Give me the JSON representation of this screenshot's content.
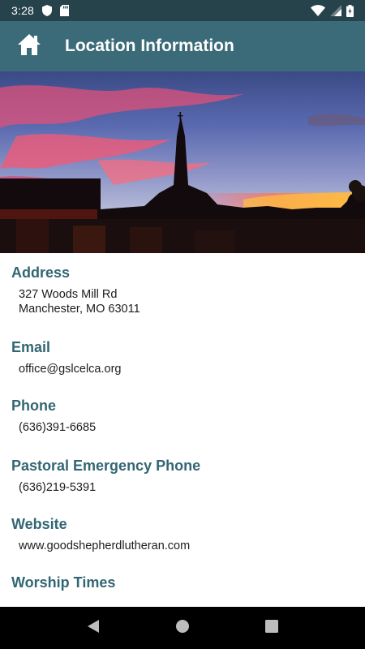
{
  "status_bar": {
    "time": "3:28",
    "icons": [
      "shield-icon",
      "sd-card-icon",
      "wifi-icon",
      "signal-icon",
      "battery-charging-icon"
    ]
  },
  "app_bar": {
    "title": "Location Information",
    "home_icon": "home-icon"
  },
  "hero": {
    "description": "church-steeple-sunset-photo"
  },
  "sections": {
    "address": {
      "label": "Address",
      "line1": "327 Woods Mill Rd",
      "line2": "Manchester, MO 63011"
    },
    "email": {
      "label": "Email",
      "value": "office@gslcelca.org"
    },
    "phone": {
      "label": "Phone",
      "value": "(636)391-6685"
    },
    "pastoral": {
      "label": "Pastoral Emergency Phone",
      "value": "(636)219-5391"
    },
    "website": {
      "label": "Website",
      "value": "www.goodshepherdlutheran.com"
    },
    "worship": {
      "label": "Worship Times"
    }
  },
  "nav_bar": {
    "icons": [
      "back-icon",
      "home-circle-icon",
      "recents-icon"
    ]
  },
  "colors": {
    "status_bar": "#26434c",
    "app_bar": "#3b6b78",
    "label": "#336673"
  }
}
